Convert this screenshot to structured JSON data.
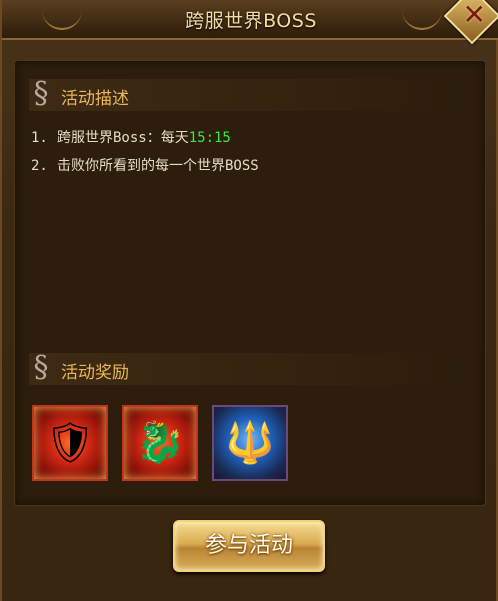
{
  "window": {
    "title": "跨服世界BOSS",
    "close_icon": "close-icon"
  },
  "description": {
    "title": "活动描述",
    "items": [
      {
        "num": "1.",
        "text": "跨服世界Boss：每天",
        "time": "15:15"
      },
      {
        "num": "2.",
        "text": "击败你所看到的每一个世界BOSS",
        "time": ""
      }
    ]
  },
  "rewards": {
    "title": "活动奖励",
    "items": [
      {
        "icon": "red-shield-icon",
        "style": "red"
      },
      {
        "icon": "dragon-scepter-icon",
        "style": "red"
      },
      {
        "icon": "blue-trident-icon",
        "style": "blue"
      }
    ]
  },
  "join_button": {
    "label": "参与活动"
  },
  "colors": {
    "accent": "#e8b85a",
    "time": "#3ee83e",
    "button": "#d9ab52"
  }
}
